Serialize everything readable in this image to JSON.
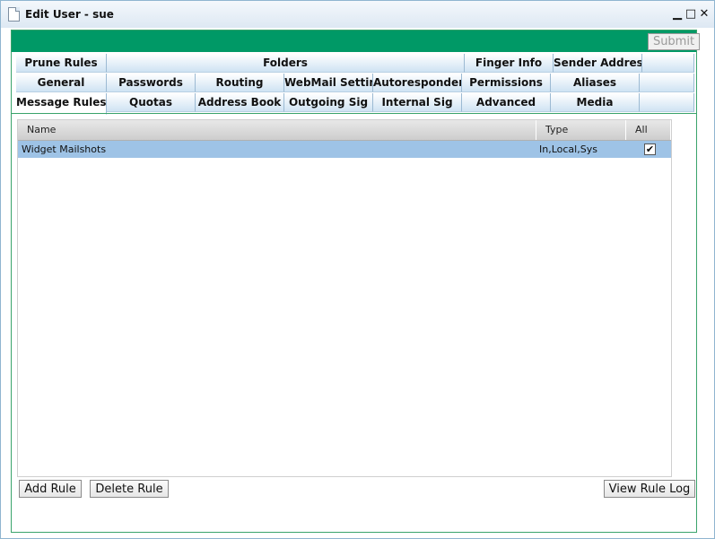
{
  "window": {
    "title": "Edit User - sue",
    "minimize_glyph": "▁",
    "maximize_glyph": "□",
    "close_glyph": "✕"
  },
  "toolbar": {
    "submit_label": "Submit"
  },
  "tabs": {
    "row1": [
      "Prune Rules",
      "Folders",
      "Finger Info",
      "Sender Address",
      ""
    ],
    "row2": [
      "General",
      "Passwords",
      "Routing",
      "WebMail Settings",
      "Autoresponder",
      "Permissions",
      "Aliases",
      ""
    ],
    "row3": [
      "Message Rules",
      "Quotas",
      "Address Book",
      "Outgoing Sig",
      "Internal Sig",
      "Advanced",
      "Media",
      ""
    ],
    "active": "Message Rules"
  },
  "rules_table": {
    "columns": [
      "Name",
      "Type",
      "All"
    ],
    "rows": [
      {
        "name": "Widget Mailshots",
        "type": "In,Local,Sys",
        "all": "✔"
      }
    ]
  },
  "buttons": {
    "add_rule": "Add Rule",
    "delete_rule": "Delete Rule",
    "view_rule_log": "View Rule Log"
  },
  "colors": {
    "accent_green": "#009966",
    "selected_row": "#9ec3e6",
    "tab_gradient_end": "#cfe3f3"
  }
}
